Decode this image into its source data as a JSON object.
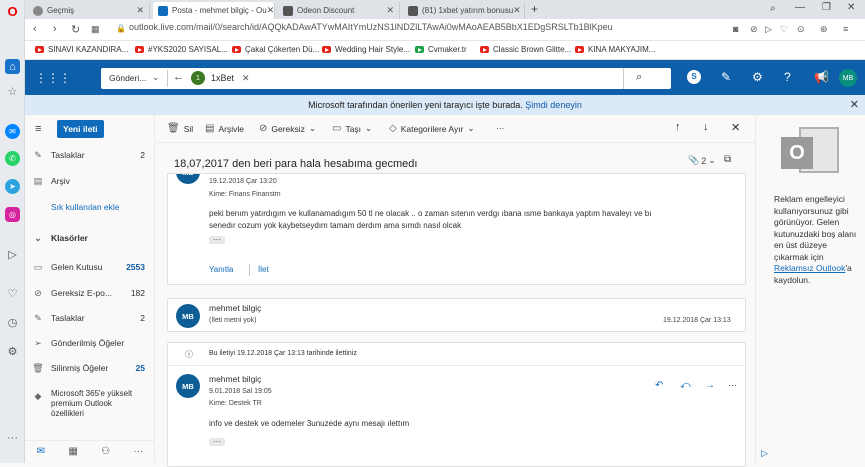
{
  "browser": {
    "tabs": [
      {
        "title": "Geçmiş",
        "active": false
      },
      {
        "title": "Posta - mehmet bilgiç - Ou",
        "active": true
      },
      {
        "title": "Odeon Discount",
        "active": false
      },
      {
        "title": "(81) 1xbet yatırım bonusu",
        "active": false
      }
    ],
    "new_tab": "+",
    "url": "outlook.live.com/mail/0/search/id/AQQkADAwATYwMAItYmUzNS1lNDZlLTAwAi0wMAoAEAB5BbX1EDgSRSLTb1BlKpeu",
    "bookmarks": [
      "SINAVI KAZANDIRA...",
      "#YKS2020 SAYISAL...",
      "Çakal Çökerten Dü...",
      "Wedding Hair Style...",
      "Cvmaker.tr",
      "Classic Brown Glitte...",
      "KINA MAKYAJIM..."
    ]
  },
  "outlook": {
    "search_scope": "Gönderi...",
    "search_chip_badge": "1",
    "search_chip_label": "1xBet",
    "avatar": "MB",
    "banner_text": "Microsoft tarafından önerilen yeni tarayıcı işte burada.",
    "banner_link": "Şimdi deneyin"
  },
  "folders": {
    "new_message": "Yeni ileti",
    "items_top": [
      {
        "label": "Taslaklar",
        "count": "2",
        "icon": "pencil-icon"
      },
      {
        "label": "Arşiv",
        "count": "",
        "icon": "archive-icon"
      }
    ],
    "add_favorite": "Sık kullanılan ekle",
    "section": "Klasörler",
    "items": [
      {
        "label": "Gelen Kutusu",
        "count": "2553",
        "icon": "inbox-icon",
        "bold": true
      },
      {
        "label": "Gereksiz E-po...",
        "count": "182",
        "icon": "junk-icon",
        "bold": false
      },
      {
        "label": "Taslaklar",
        "count": "2",
        "icon": "pencil-icon",
        "bold": false
      },
      {
        "label": "Gönderilmiş Öğeler",
        "count": "",
        "icon": "send-icon",
        "bold": false
      },
      {
        "label": "Silinmiş Öğeler",
        "count": "25",
        "icon": "trash-icon",
        "bold": true
      }
    ],
    "premium": "Microsoft 365'e yükselt premium Outlook özellikleri"
  },
  "toolbar": {
    "delete": "Sil",
    "archive": "Arşivle",
    "junk": "Gereksiz",
    "move": "Taşı",
    "categorize": "Kategorilere Ayır",
    "more": "···"
  },
  "thread": {
    "subject": "18,07,2017 den beri para hala hesabıma gecmedı",
    "attach_count": "2",
    "msg1": {
      "date": "19.12.2018 Çar 13:20",
      "to_label": "Kime:",
      "to": "Finans Finanstm",
      "body_line1": "peki benım yatırdıgım ve kullanamadıgım 50 tl ne olacak ..  o zaman sıtenın verdgı ıbana ısme bankaya yaptım havaleyı ve bı",
      "body_line2": "senedır cozum yok kaybetseydım tamam derdım ama sımdı nasıl olcak",
      "dots": "···",
      "reply": "Yanıtla",
      "forward": "İlet"
    },
    "msg2": {
      "avatar": "MB",
      "sender": "mehmet bilgiç",
      "preview": "(İleti metni yok)",
      "date": "19.12.2018 Çar 13:13"
    },
    "forward_notice": "Bu iletiyi 19.12.2018 Çar 13:13 tarihinde ilettiniz",
    "msg3": {
      "avatar": "MB",
      "sender": "mehmet bilgiç",
      "date": "9.01.2018 Sal 19:05",
      "to_label": "Kime:",
      "to": "Destek TR",
      "body": "info ve destek ve odemeler 3unuzede aynı mesajı ılettım",
      "dots": "···"
    }
  },
  "ad": {
    "text_before": "Reklam engelleyici kullanıyorsunuz gibi görünüyor. Gelen kutunuzdaki boş alanı en üst düzeye çıkarmak için",
    "link": "Reklamsız Outlook",
    "text_after": "'a kaydolun."
  }
}
